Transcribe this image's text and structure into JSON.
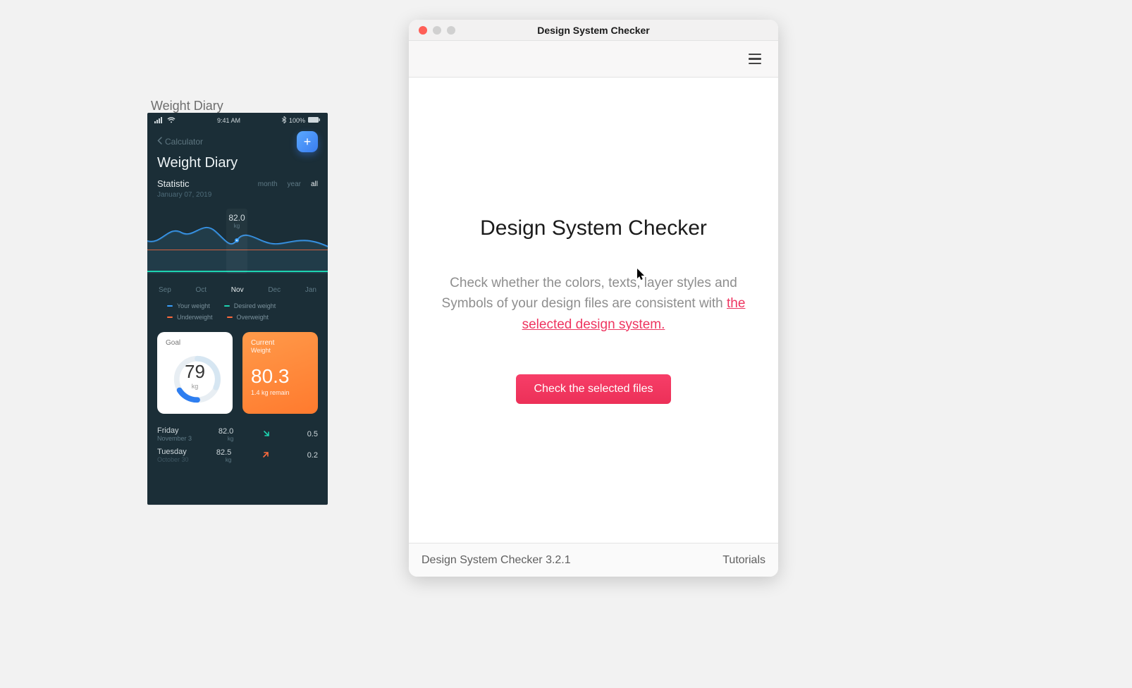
{
  "canvas": {
    "artboard_label": "Weight Diary"
  },
  "phone": {
    "status": {
      "signal": "ıııl",
      "wifi": "wifi",
      "time": "9:41 AM",
      "bt": "bt",
      "battery_pct": "100%"
    },
    "back_label": "Calculator",
    "title": "Weight Diary",
    "statistic_label": "Statistic",
    "statistic_date": "January 07, 2019",
    "tabs": {
      "month": "month",
      "year": "year",
      "all": "all"
    },
    "tooltip": {
      "value": "82.0",
      "unit": "kg"
    },
    "months": [
      "Sep",
      "Oct",
      "Nov",
      "Dec",
      "Jan"
    ],
    "legend": {
      "your_weight": "Your weight",
      "desired_weight": "Desired weight",
      "underweight": "Underweight",
      "overweight": "Overweight"
    },
    "goal_card": {
      "title": "Goal",
      "value": "79",
      "unit": "kg"
    },
    "current_card": {
      "title": "Current",
      "sub": "Weight",
      "value": "80.3",
      "remain": "1.4 kg remain"
    },
    "entries": [
      {
        "day": "Friday",
        "date": "November 3",
        "weight": "82.0",
        "unit": "kg",
        "arrow": "down",
        "delta": "0.5"
      },
      {
        "day": "Tuesday",
        "date": "October 30",
        "weight": "82.5",
        "unit": "kg",
        "arrow": "up",
        "delta": "0.2"
      }
    ]
  },
  "window": {
    "title": "Design System Checker",
    "heading": "Design System Checker",
    "desc_prefix": "Check whether the colors, texts, layer styles and Symbols of your design files are consistent with ",
    "desc_link": "the selected design system.",
    "button": "Check the selected files",
    "footer_version": "Design System Checker 3.2.1",
    "footer_tutorials": "Tutorials"
  },
  "colors": {
    "accent_blue": "#3a8cff",
    "accent_teal": "#1dd3b0",
    "accent_orange": "#ff6a3c",
    "accent_pink": "#ef3560"
  }
}
